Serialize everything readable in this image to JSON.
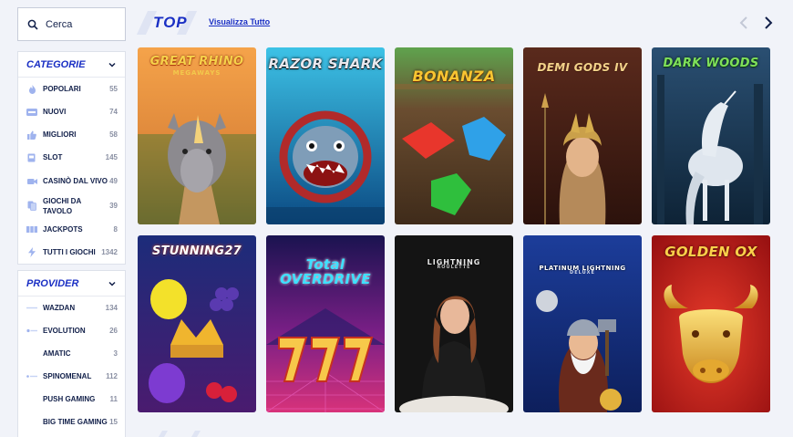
{
  "search": {
    "placeholder": "Cerca",
    "icon": "search-icon"
  },
  "categories": {
    "title": "CATEGORIE",
    "items": [
      {
        "label": "POPOLARI",
        "count": "55",
        "icon": "flame-icon"
      },
      {
        "label": "NUOVI",
        "count": "74",
        "icon": "new-badge-icon"
      },
      {
        "label": "MIGLIORI",
        "count": "58",
        "icon": "thumbs-up-icon"
      },
      {
        "label": "SLOT",
        "count": "145",
        "icon": "slot-machine-icon"
      },
      {
        "label": "CASINÒ DAL VIVO",
        "count": "49",
        "icon": "camera-icon"
      },
      {
        "label": "GIOCHI DA TAVOLO",
        "count": "39",
        "icon": "cards-icon"
      },
      {
        "label": "JACKPOTS",
        "count": "8",
        "icon": "jackpot-icon"
      },
      {
        "label": "TUTTI I GIOCHI",
        "count": "1342",
        "icon": "lightning-icon"
      }
    ]
  },
  "providers": {
    "title": "PROVIDER",
    "items": [
      {
        "label": "WAZDAN",
        "count": "134",
        "icon": "wazdan-logo-icon"
      },
      {
        "label": "EVOLUTION",
        "count": "26",
        "icon": "evolution-logo-icon"
      },
      {
        "label": "AMATIC",
        "count": "3",
        "icon": ""
      },
      {
        "label": "SPINOMENAL",
        "count": "112",
        "icon": "spinomenal-logo-icon"
      },
      {
        "label": "PUSH GAMING",
        "count": "11",
        "icon": ""
      },
      {
        "label": "BIG TIME GAMING",
        "count": "15",
        "icon": ""
      }
    ]
  },
  "section": {
    "title": "TOP",
    "view_all": "Visualizza Tutto"
  },
  "games": [
    {
      "name": "GREAT RHINO",
      "subtitle": "MEGAWAYS"
    },
    {
      "name": "RAZOR SHARK",
      "subtitle": ""
    },
    {
      "name": "BONANZA",
      "subtitle": ""
    },
    {
      "name": "DEMI GODS IV",
      "subtitle": ""
    },
    {
      "name": "DARK WOODS",
      "subtitle": ""
    },
    {
      "name": "STUNNING27",
      "subtitle": ""
    },
    {
      "name": "Total OVERDRIVE",
      "subtitle": ""
    },
    {
      "name": "LIGHTNING",
      "subtitle": "ROULETTE"
    },
    {
      "name": "PLATINUM LIGHTNING",
      "subtitle": "DELUXE"
    },
    {
      "name": "GOLDEN OX",
      "subtitle": ""
    }
  ],
  "colors": {
    "accent": "#1a2fc4",
    "background": "#f1f3f9",
    "muted": "#8a90a3"
  }
}
